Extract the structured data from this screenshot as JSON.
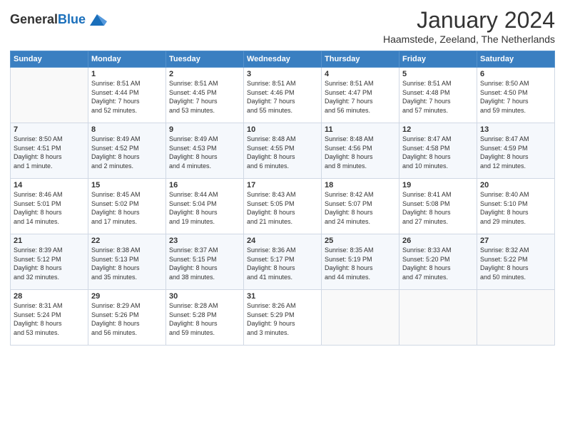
{
  "header": {
    "logo_general": "General",
    "logo_blue": "Blue",
    "month_year": "January 2024",
    "location": "Haamstede, Zeeland, The Netherlands"
  },
  "days_of_week": [
    "Sunday",
    "Monday",
    "Tuesday",
    "Wednesday",
    "Thursday",
    "Friday",
    "Saturday"
  ],
  "weeks": [
    [
      {
        "num": "",
        "info": ""
      },
      {
        "num": "1",
        "info": "Sunrise: 8:51 AM\nSunset: 4:44 PM\nDaylight: 7 hours\nand 52 minutes."
      },
      {
        "num": "2",
        "info": "Sunrise: 8:51 AM\nSunset: 4:45 PM\nDaylight: 7 hours\nand 53 minutes."
      },
      {
        "num": "3",
        "info": "Sunrise: 8:51 AM\nSunset: 4:46 PM\nDaylight: 7 hours\nand 55 minutes."
      },
      {
        "num": "4",
        "info": "Sunrise: 8:51 AM\nSunset: 4:47 PM\nDaylight: 7 hours\nand 56 minutes."
      },
      {
        "num": "5",
        "info": "Sunrise: 8:51 AM\nSunset: 4:48 PM\nDaylight: 7 hours\nand 57 minutes."
      },
      {
        "num": "6",
        "info": "Sunrise: 8:50 AM\nSunset: 4:50 PM\nDaylight: 7 hours\nand 59 minutes."
      }
    ],
    [
      {
        "num": "7",
        "info": "Sunrise: 8:50 AM\nSunset: 4:51 PM\nDaylight: 8 hours\nand 1 minute."
      },
      {
        "num": "8",
        "info": "Sunrise: 8:49 AM\nSunset: 4:52 PM\nDaylight: 8 hours\nand 2 minutes."
      },
      {
        "num": "9",
        "info": "Sunrise: 8:49 AM\nSunset: 4:53 PM\nDaylight: 8 hours\nand 4 minutes."
      },
      {
        "num": "10",
        "info": "Sunrise: 8:48 AM\nSunset: 4:55 PM\nDaylight: 8 hours\nand 6 minutes."
      },
      {
        "num": "11",
        "info": "Sunrise: 8:48 AM\nSunset: 4:56 PM\nDaylight: 8 hours\nand 8 minutes."
      },
      {
        "num": "12",
        "info": "Sunrise: 8:47 AM\nSunset: 4:58 PM\nDaylight: 8 hours\nand 10 minutes."
      },
      {
        "num": "13",
        "info": "Sunrise: 8:47 AM\nSunset: 4:59 PM\nDaylight: 8 hours\nand 12 minutes."
      }
    ],
    [
      {
        "num": "14",
        "info": "Sunrise: 8:46 AM\nSunset: 5:01 PM\nDaylight: 8 hours\nand 14 minutes."
      },
      {
        "num": "15",
        "info": "Sunrise: 8:45 AM\nSunset: 5:02 PM\nDaylight: 8 hours\nand 17 minutes."
      },
      {
        "num": "16",
        "info": "Sunrise: 8:44 AM\nSunset: 5:04 PM\nDaylight: 8 hours\nand 19 minutes."
      },
      {
        "num": "17",
        "info": "Sunrise: 8:43 AM\nSunset: 5:05 PM\nDaylight: 8 hours\nand 21 minutes."
      },
      {
        "num": "18",
        "info": "Sunrise: 8:42 AM\nSunset: 5:07 PM\nDaylight: 8 hours\nand 24 minutes."
      },
      {
        "num": "19",
        "info": "Sunrise: 8:41 AM\nSunset: 5:08 PM\nDaylight: 8 hours\nand 27 minutes."
      },
      {
        "num": "20",
        "info": "Sunrise: 8:40 AM\nSunset: 5:10 PM\nDaylight: 8 hours\nand 29 minutes."
      }
    ],
    [
      {
        "num": "21",
        "info": "Sunrise: 8:39 AM\nSunset: 5:12 PM\nDaylight: 8 hours\nand 32 minutes."
      },
      {
        "num": "22",
        "info": "Sunrise: 8:38 AM\nSunset: 5:13 PM\nDaylight: 8 hours\nand 35 minutes."
      },
      {
        "num": "23",
        "info": "Sunrise: 8:37 AM\nSunset: 5:15 PM\nDaylight: 8 hours\nand 38 minutes."
      },
      {
        "num": "24",
        "info": "Sunrise: 8:36 AM\nSunset: 5:17 PM\nDaylight: 8 hours\nand 41 minutes."
      },
      {
        "num": "25",
        "info": "Sunrise: 8:35 AM\nSunset: 5:19 PM\nDaylight: 8 hours\nand 44 minutes."
      },
      {
        "num": "26",
        "info": "Sunrise: 8:33 AM\nSunset: 5:20 PM\nDaylight: 8 hours\nand 47 minutes."
      },
      {
        "num": "27",
        "info": "Sunrise: 8:32 AM\nSunset: 5:22 PM\nDaylight: 8 hours\nand 50 minutes."
      }
    ],
    [
      {
        "num": "28",
        "info": "Sunrise: 8:31 AM\nSunset: 5:24 PM\nDaylight: 8 hours\nand 53 minutes."
      },
      {
        "num": "29",
        "info": "Sunrise: 8:29 AM\nSunset: 5:26 PM\nDaylight: 8 hours\nand 56 minutes."
      },
      {
        "num": "30",
        "info": "Sunrise: 8:28 AM\nSunset: 5:28 PM\nDaylight: 8 hours\nand 59 minutes."
      },
      {
        "num": "31",
        "info": "Sunrise: 8:26 AM\nSunset: 5:29 PM\nDaylight: 9 hours\nand 3 minutes."
      },
      {
        "num": "",
        "info": ""
      },
      {
        "num": "",
        "info": ""
      },
      {
        "num": "",
        "info": ""
      }
    ]
  ]
}
